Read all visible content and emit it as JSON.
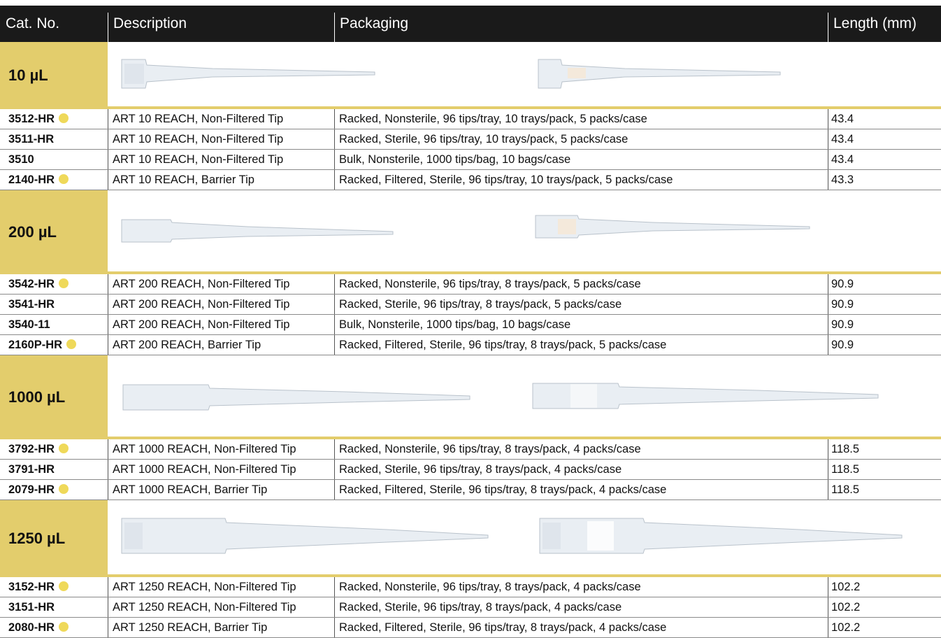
{
  "header": {
    "cat": "Cat. No.",
    "desc": "Description",
    "pack": "Packaging",
    "len": "Length (mm)"
  },
  "colors": {
    "header_bg": "#1a1a1a",
    "band_gold": "#e3cd6c",
    "dot_yellow": "#efd95a"
  },
  "sections": [
    {
      "label": "10 µL",
      "rows": [
        {
          "cat": "3512-HR",
          "dot": true,
          "desc": "ART 10 REACH, Non-Filtered Tip",
          "pack": "Racked, Nonsterile, 96 tips/tray, 10 trays/pack, 5 packs/case",
          "len": "43.4"
        },
        {
          "cat": "3511-HR",
          "dot": false,
          "desc": "ART 10 REACH, Non-Filtered Tip",
          "pack": "Racked, Sterile, 96 tips/tray, 10 trays/pack, 5 packs/case",
          "len": "43.4"
        },
        {
          "cat": "3510",
          "dot": false,
          "desc": "ART 10 REACH, Non-Filtered Tip",
          "pack": "Bulk, Nonsterile, 1000 tips/bag, 10 bags/case",
          "len": "43.4"
        },
        {
          "cat": "2140-HR",
          "dot": true,
          "desc": "ART 10 REACH, Barrier Tip",
          "pack": "Racked, Filtered, Sterile, 96 tips/tray, 10 trays/pack, 5 packs/case",
          "len": "43.3"
        }
      ]
    },
    {
      "label": "200 µL",
      "rows": [
        {
          "cat": "3542-HR",
          "dot": true,
          "desc": "ART 200 REACH, Non-Filtered Tip",
          "pack": "Racked, Nonsterile, 96 tips/tray, 8 trays/pack, 5 packs/case",
          "len": "90.9"
        },
        {
          "cat": "3541-HR",
          "dot": false,
          "desc": "ART 200 REACH, Non-Filtered Tip",
          "pack": "Racked, Sterile, 96 tips/tray, 8 trays/pack, 5 packs/case",
          "len": "90.9"
        },
        {
          "cat": "3540-11",
          "dot": false,
          "desc": "ART 200 REACH, Non-Filtered Tip",
          "pack": "Bulk, Nonsterile, 1000 tips/bag, 10 bags/case",
          "len": "90.9"
        },
        {
          "cat": "2160P-HR",
          "dot": true,
          "desc": "ART 200 REACH, Barrier Tip",
          "pack": "Racked, Filtered, Sterile, 96 tips/tray, 8 trays/pack, 5 packs/case",
          "len": "90.9"
        }
      ]
    },
    {
      "label": "1000 µL",
      "rows": [
        {
          "cat": "3792-HR",
          "dot": true,
          "desc": "ART 1000 REACH, Non-Filtered Tip",
          "pack": "Racked, Nonsterile, 96 tips/tray, 8 trays/pack, 4 packs/case",
          "len": "118.5"
        },
        {
          "cat": "3791-HR",
          "dot": false,
          "desc": "ART 1000 REACH, Non-Filtered Tip",
          "pack": "Racked, Sterile, 96 tips/tray, 8 trays/pack, 4 packs/case",
          "len": "118.5"
        },
        {
          "cat": "2079-HR",
          "dot": true,
          "desc": "ART 1000 REACH, Barrier Tip",
          "pack": "Racked, Filtered, Sterile, 96 tips/tray, 8 trays/pack, 4 packs/case",
          "len": "118.5"
        }
      ]
    },
    {
      "label": "1250 µL",
      "rows": [
        {
          "cat": "3152-HR",
          "dot": true,
          "desc": "ART 1250 REACH, Non-Filtered Tip",
          "pack": "Racked, Nonsterile, 96 tips/tray, 8 trays/pack, 4 packs/case",
          "len": "102.2"
        },
        {
          "cat": "3151-HR",
          "dot": false,
          "desc": "ART 1250 REACH, Non-Filtered Tip",
          "pack": "Racked, Sterile, 96 tips/tray, 8 trays/pack, 4 packs/case",
          "len": "102.2"
        },
        {
          "cat": "2080-HR",
          "dot": true,
          "desc": "ART 1250 REACH, Barrier Tip",
          "pack": "Racked, Filtered, Sterile, 96 tips/tray, 8 trays/pack, 4 packs/case",
          "len": "102.2"
        }
      ]
    }
  ]
}
